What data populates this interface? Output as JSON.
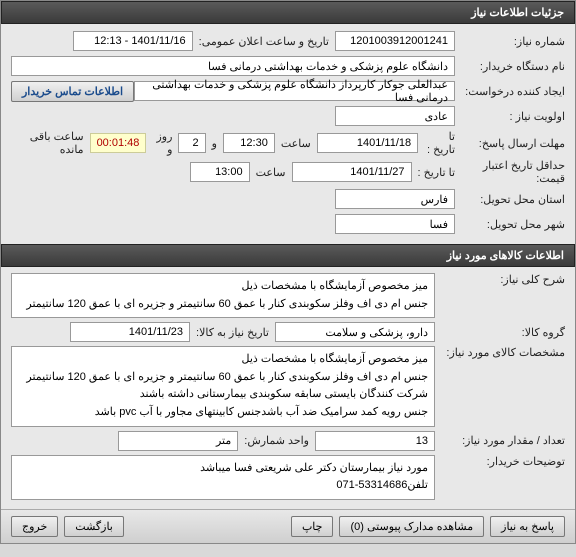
{
  "header1": "جزئیات اطلاعات نیاز",
  "header2": "اطلاعات کالاهای مورد نیاز",
  "labels": {
    "req_no": "شماره نیاز:",
    "announce_date": "تاریخ و ساعت اعلان عمومی:",
    "org_name": "نام دستگاه خریدار:",
    "requester": "ایجاد کننده درخواست:",
    "priority": "اولویت نیاز :",
    "answer_deadline": "مهلت ارسال پاسخ:",
    "to_date": "تا تاریخ :",
    "hour": "ساعت",
    "and": "و",
    "day": "روز و",
    "hour_remain": "ساعت باقی مانده",
    "valid_until": "حداقل تاریخ اعتبار قیمت:",
    "province": "استان محل تحویل:",
    "city": "شهر محل تحویل:",
    "gen_desc": "شرح کلی نیاز:",
    "goods_group": "گروه کالا:",
    "goods_date": "تاریخ نیاز به کالا:",
    "goods_spec": "مشخصات کالای مورد نیاز:",
    "qty": "تعداد / مقدار مورد نیاز:",
    "unit": "واحد شمارش:",
    "buyer_notes": "توضیحات خریدار:",
    "contact_btn": "اطلاعات تماس خریدار"
  },
  "values": {
    "req_no": "1201003912001241",
    "announce_date": "1401/11/16 - 12:13",
    "org_name": "دانشگاه علوم پزشکی و خدمات بهداشتی درمانی فسا",
    "requester": "عبدالعلی جوکار کارپرداز دانشگاه علوم پزشکی و خدمات بهداشتی درمانی فسا",
    "priority": "عادی",
    "deadline_date": "1401/11/18",
    "deadline_time": "12:30",
    "days_remain": "2",
    "timer": "00:01:48",
    "valid_date": "1401/11/27",
    "valid_time": "13:00",
    "province": "فارس",
    "city": "فسا",
    "gen_desc_l1": "میز مخصوص آزمایشگاه با مشخصات ذیل",
    "gen_desc_l2": "جنس ام دی اف وفلز سکوبندی کنار با عمق 60 سانتیمتر و جزیره ای با عمق 120 سانتیمتر",
    "goods_group": "دارو، پزشکی و سلامت",
    "goods_date": "1401/11/23",
    "spec_l1": "میز مخصوص آزمایشگاه با مشخصات ذیل",
    "spec_l2": "جنس ام دی اف وفلز سکوبندی کنار با عمق 60 سانتیمتر و جزیره ای با عمق 120 سانتیمتر",
    "spec_l3": "شرکت کنندگان بایستی سابقه سکوبندی بیمارستانی داشته باشند",
    "spec_l4": "جنس رویه کمد سرامیک ضد آب باشدجنس کابینتهای مجاور با آب pvc باشد",
    "qty": "13",
    "unit": "متر",
    "notes_l1": "مورد نیاز بیمارستان دکتر علی شریعتی فسا میباشد",
    "notes_l2": "تلفن53314686-071"
  },
  "footer": {
    "reply": "پاسخ به نیاز",
    "attach": "مشاهده مدارک پیوستی",
    "attach_count": "(0)",
    "print": "چاپ",
    "back": "بازگشت",
    "exit": "خروج"
  }
}
